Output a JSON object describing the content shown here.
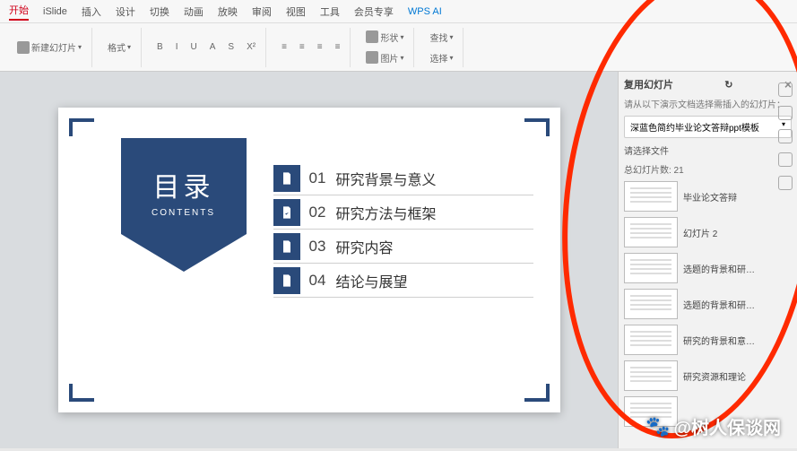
{
  "ribbon": {
    "tabs": [
      "开始",
      "iSlide",
      "插入",
      "设计",
      "切换",
      "动画",
      "放映",
      "审阅",
      "视图",
      "工具",
      "会员专享",
      "WPS AI"
    ],
    "status": "",
    "new_slide": "新建幻灯片",
    "format": "格式",
    "shape": "形状",
    "picture": "图片",
    "find": "查找",
    "select": "选择"
  },
  "slide": {
    "title_cn": "目录",
    "title_en": "CONTENTS",
    "items": [
      {
        "num": "01",
        "text": "研究背景与意义"
      },
      {
        "num": "02",
        "text": "研究方法与框架"
      },
      {
        "num": "03",
        "text": "研究内容"
      },
      {
        "num": "04",
        "text": "结论与展望"
      }
    ]
  },
  "panel": {
    "title": "复用幻灯片",
    "hint": "请从以下演示文档选择需插入的幻灯片：",
    "select_value": "深蓝色简约毕业论文答辩ppt模板",
    "choose_file": "请选择文件",
    "count_label": "总幻灯片数: 21",
    "thumbs": [
      {
        "label": "毕业论文答辩"
      },
      {
        "label": "幻灯片 2"
      },
      {
        "label": "选题的背景和研…"
      },
      {
        "label": "选题的背景和研…"
      },
      {
        "label": "研究的背景和意…"
      },
      {
        "label": "研究资源和理论"
      },
      {
        "label": ""
      }
    ]
  },
  "watermark": "@树人保谈网"
}
